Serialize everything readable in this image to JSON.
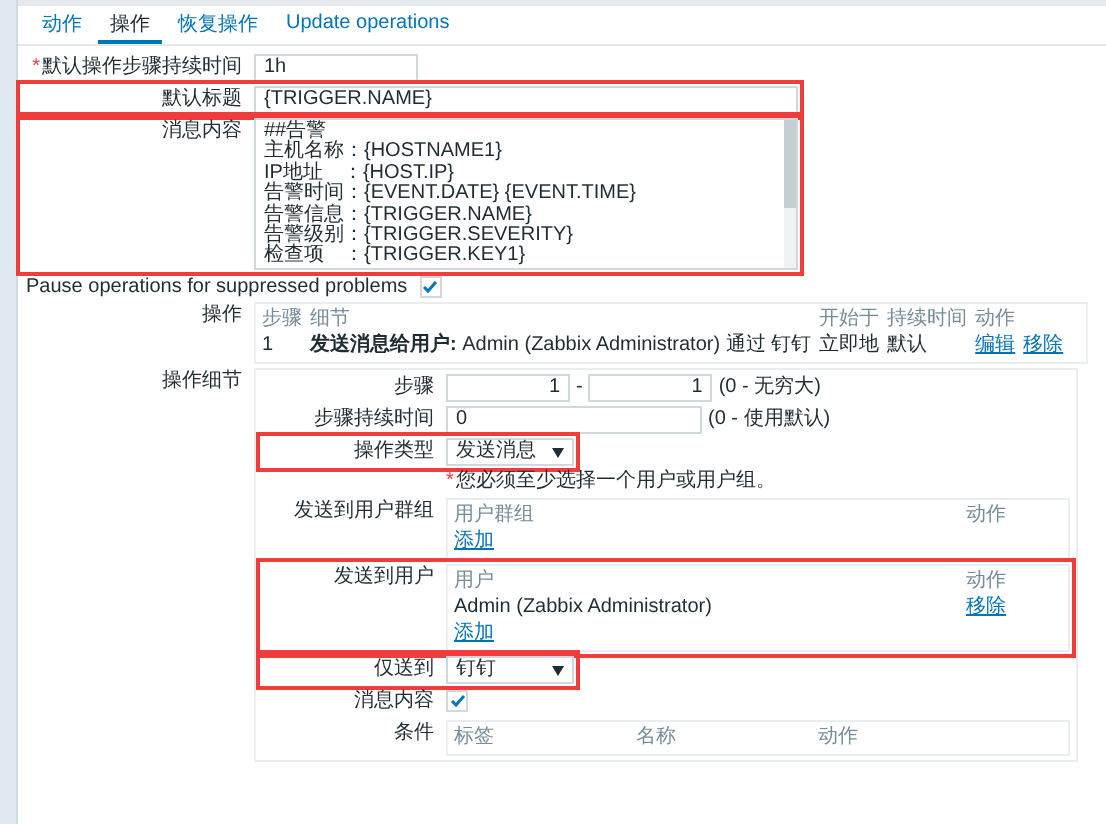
{
  "tabs": [
    {
      "label": "动作",
      "selected": false
    },
    {
      "label": "操作",
      "selected": true
    },
    {
      "label": "恢复操作",
      "selected": false
    },
    {
      "label": "Update operations",
      "selected": false
    }
  ],
  "form": {
    "default_duration": {
      "marker": "*",
      "label": "默认操作步骤持续时间",
      "value": "1h"
    },
    "default_subject": {
      "label": "默认标题",
      "value": "{TRIGGER.NAME}",
      "highlighted": true
    },
    "default_message": {
      "label": "消息内容",
      "highlighted": true,
      "lines": [
        "##告警",
        "主机名称：{HOSTNAME1}",
        "IP地址　：{HOST.IP}",
        "告警时间：{EVENT.DATE} {EVENT.TIME}",
        "告警信息：{TRIGGER.NAME}",
        "告警级别：{TRIGGER.SEVERITY}",
        "检查项　：{TRIGGER.KEY1}"
      ]
    },
    "pause_suppressed": {
      "label": "Pause operations for suppressed problems",
      "checked": true
    },
    "operations": {
      "label": "操作",
      "columns": [
        "步骤",
        "细节",
        "开始于",
        "持续时间",
        "动作"
      ],
      "rows": [
        {
          "step": "1",
          "detail": "**发送消息给用户:** Admin (Zabbix Administrator) 通过 钉钉",
          "start": "立即地",
          "duration": "默认",
          "actions": [
            "编辑",
            "移除"
          ]
        }
      ]
    },
    "operation_details": {
      "label": "操作细节",
      "steps": {
        "label": "步骤",
        "from": "1",
        "separator": "-",
        "to": "1",
        "hint": "(0 - 无穷大)"
      },
      "step_duration": {
        "label": "步骤持续时间",
        "value": "0",
        "hint": "(0 - 使用默认)"
      },
      "operation_type": {
        "label": "操作类型",
        "value": "发送消息",
        "highlighted": true
      },
      "warning": {
        "marker": "*",
        "text": "您必须至少选择一个用户或用户组。"
      },
      "user_groups": {
        "label": "发送到用户群组",
        "columns": [
          "用户群组",
          "动作"
        ],
        "add_link": "添加"
      },
      "users": {
        "label": "发送到用户",
        "columns": [
          "用户",
          "动作"
        ],
        "rows": [
          {
            "name": "Admin (Zabbix Administrator)",
            "action": "移除"
          }
        ],
        "add_link": "添加",
        "highlighted": true
      },
      "send_only_to": {
        "label": "仅送到",
        "value": "钉钉",
        "highlighted": true
      },
      "custom_message": {
        "label": "消息内容",
        "checked": true
      },
      "conditions": {
        "label": "条件",
        "columns": [
          "标签",
          "名称",
          "动作"
        ]
      }
    }
  }
}
